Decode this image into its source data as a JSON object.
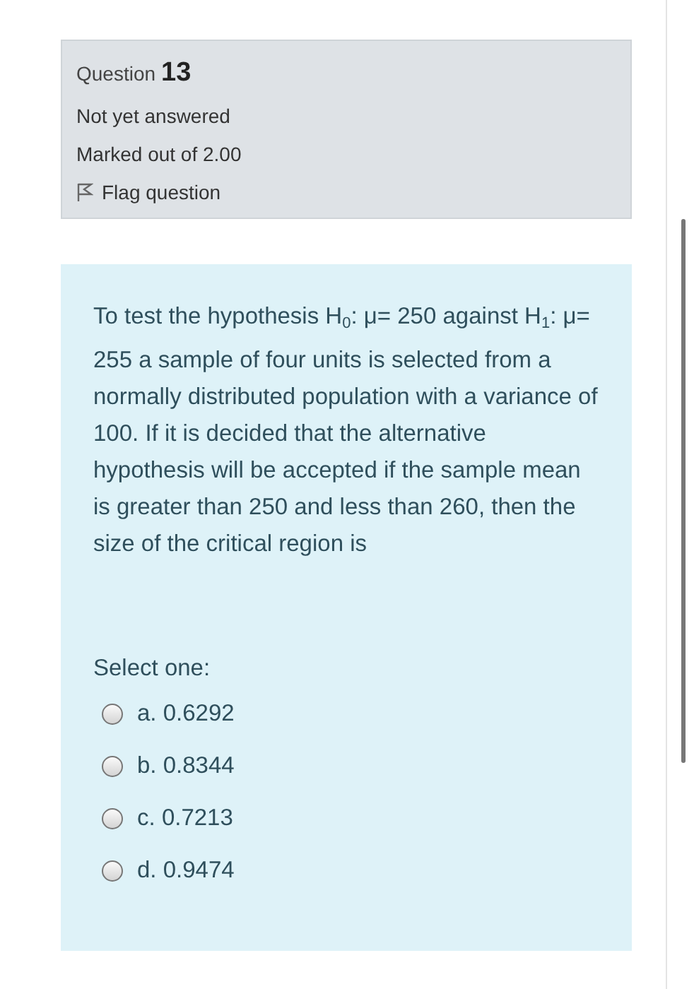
{
  "info": {
    "question_label": "Question",
    "question_number": "13",
    "status": "Not yet answered",
    "marks": "Marked out of 2.00",
    "flag": {
      "label": "Flag question",
      "flagged": false
    }
  },
  "question": {
    "text": "To test the hypothesis H$_{0}$: μ= 250 against H$_{1}$: μ= 255 a sample of four units is selected from a normally distributed population with a variance of 100. If it is decided that the alternative hypothesis will be accepted if the sample mean is greater than 250 and less than 260, then the size of the critical region is",
    "prompt": "Select one:",
    "options": [
      {
        "letter": "a.",
        "value": "0.6292",
        "selected": false
      },
      {
        "letter": "b.",
        "value": "0.8344",
        "selected": false
      },
      {
        "letter": "c.",
        "value": "0.7213",
        "selected": false
      },
      {
        "letter": "d.",
        "value": "0.9474",
        "selected": false
      }
    ]
  }
}
